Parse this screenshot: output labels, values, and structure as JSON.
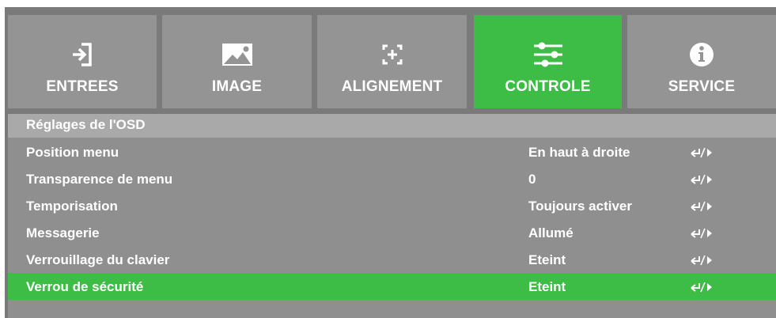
{
  "tabs": [
    {
      "label": "ENTREES",
      "icon": "input-icon",
      "active": false
    },
    {
      "label": "IMAGE",
      "icon": "image-icon",
      "active": false
    },
    {
      "label": "ALIGNEMENT",
      "icon": "alignment-icon",
      "active": false
    },
    {
      "label": "CONTROLE",
      "icon": "sliders-icon",
      "active": true
    },
    {
      "label": "SERVICE",
      "icon": "info-icon",
      "active": false
    }
  ],
  "section": {
    "title": "Réglages de l'OSD"
  },
  "rows": [
    {
      "name": "Position menu",
      "value": "En haut à droite",
      "adjust_icon": "enter-arrow-icon",
      "selected": false
    },
    {
      "name": "Transparence de menu",
      "value": "0",
      "adjust_icon": "enter-arrow-icon",
      "selected": false
    },
    {
      "name": "Temporisation",
      "value": "Toujours activer",
      "adjust_icon": "enter-arrow-icon",
      "selected": false
    },
    {
      "name": "Messagerie",
      "value": "Allumé",
      "adjust_icon": "enter-arrow-icon",
      "selected": false
    },
    {
      "name": "Verrouillage du clavier",
      "value": "Eteint",
      "adjust_icon": "enter-arrow-icon",
      "selected": false
    },
    {
      "name": "Verrou de sécurité",
      "value": "Eteint",
      "adjust_icon": "enter-arrow-icon",
      "selected": true
    }
  ],
  "colors": {
    "accent": "#3ebd46",
    "tab_bg": "#949494",
    "header_bg": "#a9a9a9",
    "panel_bg": "#8f8f8f",
    "frame_bg": "#7a7a7a",
    "text": "#ffffff"
  }
}
